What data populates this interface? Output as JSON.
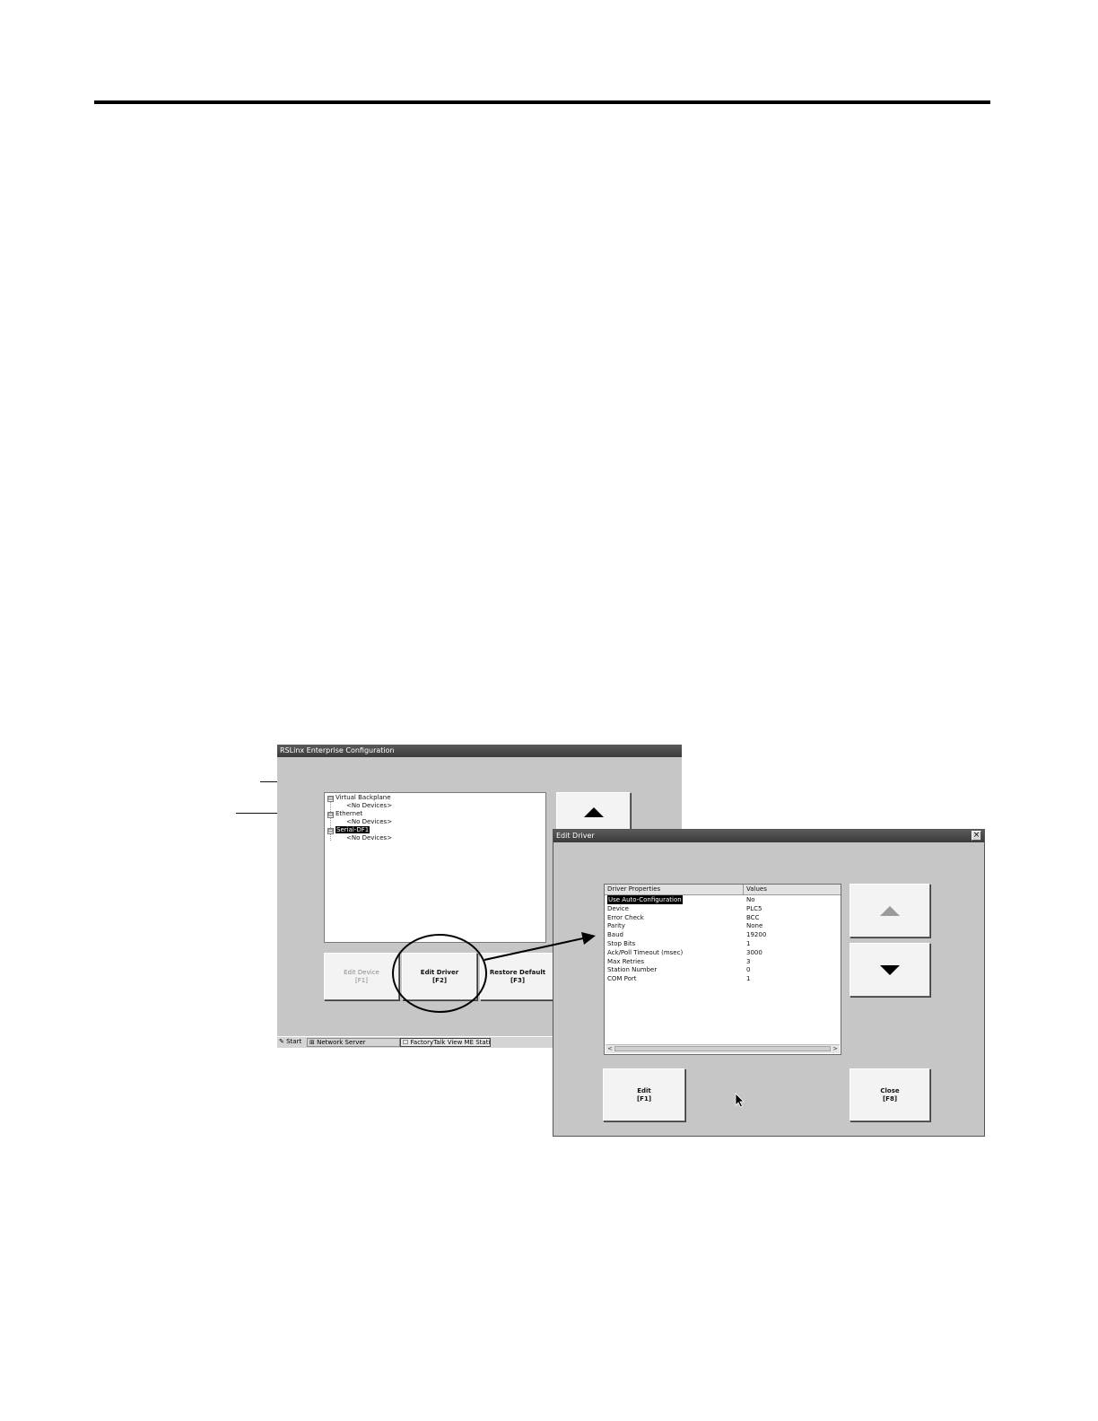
{
  "rslinx_window": {
    "title": "RSLinx Enterprise Configuration",
    "tree": [
      {
        "label": "Virtual Backplane",
        "child": "<No Devices>",
        "expander": "⊟"
      },
      {
        "label": "Ethernet",
        "child": "<No Devices>",
        "expander": "⊟"
      },
      {
        "label": "Serial-DF1",
        "child": "<No Devices>",
        "expander": "⊟",
        "selected": true
      }
    ],
    "buttons": {
      "edit_device": {
        "label": "Edit Device",
        "key": "[F1]"
      },
      "edit_driver": {
        "label": "Edit Driver",
        "key": "[F2]"
      },
      "restore_default": {
        "label": "Restore Default",
        "key": "[F3]"
      }
    },
    "taskbar": {
      "start": "Start",
      "network_server": "Network Server",
      "factorytalk": "FactoryTalk View ME Station"
    }
  },
  "edit_driver_window": {
    "title": "Edit Driver",
    "close_glyph": "×",
    "table": {
      "headers": [
        "Driver Properties",
        "Values"
      ],
      "rows": [
        {
          "property": "Use Auto-Configuration",
          "value": "No",
          "selected": true
        },
        {
          "property": "Device",
          "value": "PLC5"
        },
        {
          "property": "Error Check",
          "value": "BCC"
        },
        {
          "property": "Parity",
          "value": "None"
        },
        {
          "property": "Baud",
          "value": "19200"
        },
        {
          "property": "Stop Bits",
          "value": "1"
        },
        {
          "property": "Ack/Poll Timeout (msec)",
          "value": "3000"
        },
        {
          "property": "Max Retries",
          "value": "3"
        },
        {
          "property": "Station Number",
          "value": "0"
        },
        {
          "property": "COM Port",
          "value": "1"
        }
      ]
    },
    "buttons": {
      "edit": {
        "label": "Edit",
        "key": "[F1]"
      },
      "close": {
        "label": "Close",
        "key": "[F8]"
      }
    },
    "scroll_left": "<",
    "scroll_right": ">"
  },
  "icons": {
    "scroll_up": "up-arrow-icon",
    "scroll_down": "down-arrow-icon",
    "cursor": "mouse-pointer-icon",
    "start": "start-icon"
  },
  "colors": {
    "window_bg": "#c6c6c6",
    "titlebar": "#3a3a3a",
    "selection": "#000000"
  }
}
